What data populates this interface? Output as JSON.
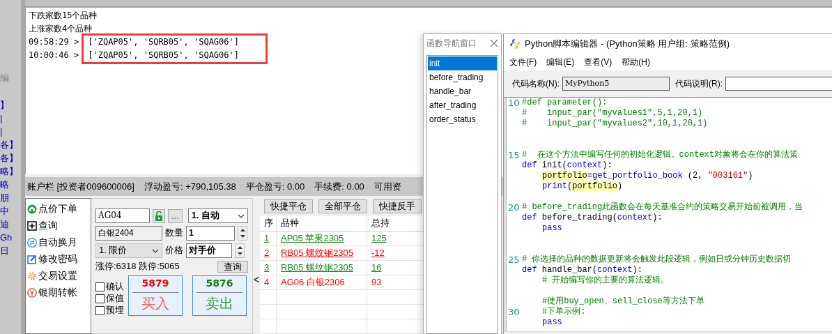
{
  "side_fragments": [
    "编",
    "】",
    "|",
    "|",
    "各】",
    "各】",
    "略】",
    "略",
    "朋",
    "中",
    "迪",
    "Gh",
    "日"
  ],
  "log": {
    "lines": [
      {
        "kind": "text",
        "text": "下跌家数15个品种",
        "highlighted": false
      },
      {
        "kind": "text",
        "text": "上涨家数4个品种",
        "highlighted": false
      },
      {
        "kind": "timed",
        "time": "09:58:29 >",
        "text": "['ZQAP05', 'SQRB05', 'SQAG06']",
        "highlighted": true
      },
      {
        "kind": "timed",
        "time": "10:00:46 >",
        "text": "['ZQAP05', 'SQRB05', 'SQAG06']",
        "highlighted": true
      }
    ]
  },
  "account_bar": [
    "账户栏 [投资者009600006]",
    "浮动盈亏: +790,105.38",
    "平仓盈亏: 0.00",
    "手续费: 0.00",
    "可用资"
  ],
  "menu": [
    {
      "kind": "order",
      "label": "点价下单"
    },
    {
      "kind": "query",
      "label": "查询"
    },
    {
      "kind": "rollover",
      "label": "自动换月"
    },
    {
      "kind": "password",
      "label": "修改密码"
    },
    {
      "kind": "settings",
      "label": "交易设置"
    },
    {
      "kind": "transfer",
      "label": "银期转帐"
    }
  ],
  "order_form": {
    "code": "AG04",
    "more": "...",
    "exec_mode": "1. 自动",
    "name": "白银2404",
    "qty_label": "数量",
    "qty": "1",
    "price_type": "1. 限价",
    "price_label": "价格",
    "price": "对手价",
    "limit_info": "涨停:6318 跌停:5065",
    "query": "查询",
    "options": [
      {
        "label": "确认",
        "checked": false
      },
      {
        "label": "保值",
        "checked": false
      },
      {
        "label": "预埋",
        "checked": false
      }
    ],
    "buy": {
      "price": "5879",
      "label": "买入"
    },
    "sell": {
      "price": "5876",
      "label": "卖出"
    }
  },
  "collapse": "<",
  "positions": {
    "buttons": [
      "快捷平仓",
      "全部平仓",
      "快捷反手"
    ],
    "columns": [
      "序",
      "品种",
      "总持"
    ],
    "rows": [
      {
        "cells": [
          "1",
          "AP05 苹果2305",
          "125"
        ],
        "color": "#1a8a1a",
        "underlined": true
      },
      {
        "cells": [
          "2",
          "RB05 螺纹钢2305",
          "-12"
        ],
        "color": "#ff0000",
        "underlined": true
      },
      {
        "cells": [
          "3",
          "RB05 螺纹钢2305",
          "16"
        ],
        "color": "#1a8a1a",
        "underlined": true
      },
      {
        "cells": [
          "4",
          "AG06 白银2306",
          "93"
        ],
        "color": "#ff0000",
        "underlined": false
      }
    ]
  },
  "navigator": {
    "title": "函数导航窗口",
    "items": [
      {
        "label": "init",
        "selected": true
      },
      {
        "label": "before_trading",
        "selected": false
      },
      {
        "label": "handle_bar",
        "selected": false
      },
      {
        "label": "after_trading",
        "selected": false
      },
      {
        "label": "order_status",
        "selected": false
      }
    ]
  },
  "editor": {
    "title": "Python脚本编辑器 - (Python策略 用户组: 策略范例)",
    "menu": [
      "文件(F)",
      "编辑(E)",
      "查看(V)",
      "帮助(H)"
    ],
    "name_label": "代码名称(N):",
    "name_value": "MyPython5",
    "desc_label": "代码说明(R):",
    "lines": [
      {
        "kind": "code",
        "number": "10",
        "segments": [
          {
            "kind": "comment",
            "text": "#def parameter():"
          }
        ]
      },
      {
        "kind": "code",
        "segments": [
          {
            "kind": "comment",
            "text": "#    input_par(\"myvalues1\",5,1,20,1)"
          }
        ]
      },
      {
        "kind": "code",
        "segments": [
          {
            "kind": "comment",
            "text": "#    input_par(\"myvalues2\",10,1,20,1)"
          }
        ]
      },
      {
        "kind": "blank"
      },
      {
        "kind": "blank"
      },
      {
        "kind": "code",
        "number": "15",
        "segments": [
          {
            "kind": "comment",
            "text": "#  在这个方法中编写任何的初始化逻辑。context对象将会在你的算法策"
          }
        ]
      },
      {
        "kind": "code",
        "segments": [
          {
            "kind": "keyword",
            "text": "def"
          },
          {
            "kind": "plain",
            "text": " init("
          },
          {
            "kind": "keyword",
            "text": "context"
          },
          {
            "kind": "plain",
            "text": "):"
          }
        ]
      },
      {
        "kind": "code",
        "indent": true,
        "segments": [
          {
            "kind": "highlight",
            "text": "portfolio"
          },
          {
            "kind": "plain",
            "text": "="
          },
          {
            "kind": "keyword",
            "text": "get_portfolio_book"
          },
          {
            "kind": "plain",
            "text": " (2, "
          },
          {
            "kind": "string",
            "text": "\"003161\""
          },
          {
            "kind": "plain",
            "text": ")"
          }
        ]
      },
      {
        "kind": "code",
        "indent": true,
        "segments": [
          {
            "kind": "keyword",
            "text": "print"
          },
          {
            "kind": "plain",
            "text": "("
          },
          {
            "kind": "highlight",
            "text": "portfolio"
          },
          {
            "kind": "plain",
            "text": ")"
          }
        ]
      },
      {
        "kind": "blank"
      },
      {
        "kind": "code",
        "number": "20",
        "segments": [
          {
            "kind": "comment",
            "text": "# before_trading此函数会在每天基准合约的策略交易开始前被调用，当"
          }
        ]
      },
      {
        "kind": "code",
        "segments": [
          {
            "kind": "keyword",
            "text": "def"
          },
          {
            "kind": "plain",
            "text": " before_trading("
          },
          {
            "kind": "keyword",
            "text": "context"
          },
          {
            "kind": "plain",
            "text": "):"
          }
        ]
      },
      {
        "kind": "code",
        "indent": true,
        "segments": [
          {
            "kind": "keyword",
            "text": "pass"
          }
        ]
      },
      {
        "kind": "blank"
      },
      {
        "kind": "blank"
      },
      {
        "kind": "code",
        "number": "25",
        "segments": [
          {
            "kind": "comment",
            "text": "# 你选择的品种的数据更新将会触发此段逻辑，例如日或分钟历史数据切"
          }
        ]
      },
      {
        "kind": "code",
        "segments": [
          {
            "kind": "keyword",
            "text": "def"
          },
          {
            "kind": "plain",
            "text": " handle_bar("
          },
          {
            "kind": "keyword",
            "text": "context"
          },
          {
            "kind": "plain",
            "text": "):"
          }
        ]
      },
      {
        "kind": "code",
        "indent": true,
        "segments": [
          {
            "kind": "comment",
            "text": "# 开始编写你的主要的算法逻辑。"
          }
        ]
      },
      {
        "kind": "blank"
      },
      {
        "kind": "code",
        "indent": true,
        "segments": [
          {
            "kind": "comment",
            "text": "#使用buy_open、sell_close等方法下单"
          }
        ]
      },
      {
        "kind": "code",
        "number": "30",
        "indent": true,
        "segments": [
          {
            "kind": "comment",
            "text": "#下单示例:"
          }
        ]
      },
      {
        "kind": "code",
        "indent": true,
        "segments": [
          {
            "kind": "keyword",
            "text": "pass"
          }
        ]
      }
    ]
  }
}
